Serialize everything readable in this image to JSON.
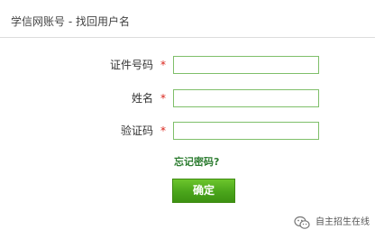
{
  "header": {
    "title": "学信网账号 - 找回用户名"
  },
  "form": {
    "fields": [
      {
        "label": "证件号码",
        "required_mark": "*",
        "value": ""
      },
      {
        "label": "姓名",
        "required_mark": "*",
        "value": ""
      },
      {
        "label": "验证码",
        "required_mark": "*",
        "value": ""
      }
    ],
    "forgot_password_link": "忘记密码?",
    "confirm_button": "确定"
  },
  "watermark": {
    "icon": "wechat-icon",
    "text": "自主招生在线"
  },
  "colors": {
    "accent_green": "#4aa51b",
    "input_border": "#7fbf6a",
    "required_star": "#d9241b",
    "link_green": "#2e7d32"
  }
}
